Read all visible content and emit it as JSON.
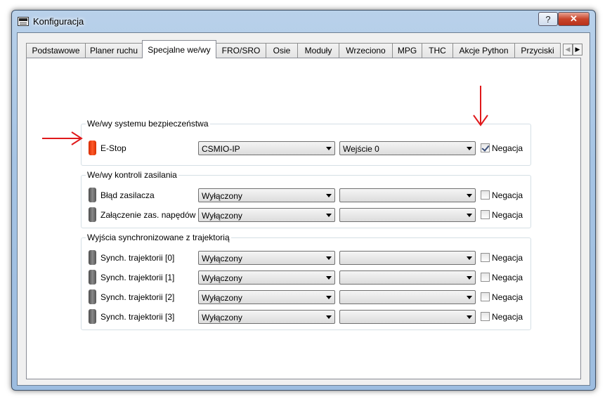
{
  "window": {
    "title": "Konfiguracja",
    "help_glyph": "?",
    "close_glyph": "✕"
  },
  "tabs": [
    {
      "label": "Podstawowe",
      "active": false
    },
    {
      "label": "Planer ruchu",
      "active": false
    },
    {
      "label": "Specjalne we/wy",
      "active": true
    },
    {
      "label": "FRO/SRO",
      "active": false
    },
    {
      "label": "Osie",
      "active": false
    },
    {
      "label": "Moduły",
      "active": false
    },
    {
      "label": "Wrzeciono",
      "active": false
    },
    {
      "label": "MPG",
      "active": false
    },
    {
      "label": "THC",
      "active": false
    },
    {
      "label": "Akcje Python",
      "active": false
    },
    {
      "label": "Przyciski",
      "active": false
    }
  ],
  "tab_scroll": {
    "left_glyph": "◀",
    "right_glyph": "▶"
  },
  "groups": [
    {
      "title": "We/wy systemu bezpieczeństwa",
      "rows": [
        {
          "label": "E-Stop",
          "led": "red",
          "device": "CSMIO-IP",
          "pin": "Wejście 0",
          "negation_checked": true,
          "negation_label": "Negacja"
        }
      ]
    },
    {
      "title": "We/wy kontroli zasilania",
      "rows": [
        {
          "label": "Błąd zasilacza",
          "led": "gray",
          "device": "Wyłączony",
          "pin": "",
          "negation_checked": false,
          "negation_label": "Negacja"
        },
        {
          "label": "Załączenie zas. napędów",
          "led": "gray",
          "device": "Wyłączony",
          "pin": "",
          "negation_checked": false,
          "negation_label": "Negacja"
        }
      ]
    },
    {
      "title": "Wyjścia synchronizowane z trajektorią",
      "rows": [
        {
          "label": "Synch. trajektorii [0]",
          "led": "gray",
          "device": "Wyłączony",
          "pin": "",
          "negation_checked": false,
          "negation_label": "Negacja"
        },
        {
          "label": "Synch. trajektorii [1]",
          "led": "gray",
          "device": "Wyłączony",
          "pin": "",
          "negation_checked": false,
          "negation_label": "Negacja"
        },
        {
          "label": "Synch. trajektorii [2]",
          "led": "gray",
          "device": "Wyłączony",
          "pin": "",
          "negation_checked": false,
          "negation_label": "Negacja"
        },
        {
          "label": "Synch. trajektorii [3]",
          "led": "gray",
          "device": "Wyłączony",
          "pin": "",
          "negation_checked": false,
          "negation_label": "Negacja"
        }
      ]
    }
  ],
  "colors": {
    "annotation_arrow": "#e0191b",
    "led_active": "#ff4a1a",
    "led_inactive": "#6a6a6a"
  }
}
